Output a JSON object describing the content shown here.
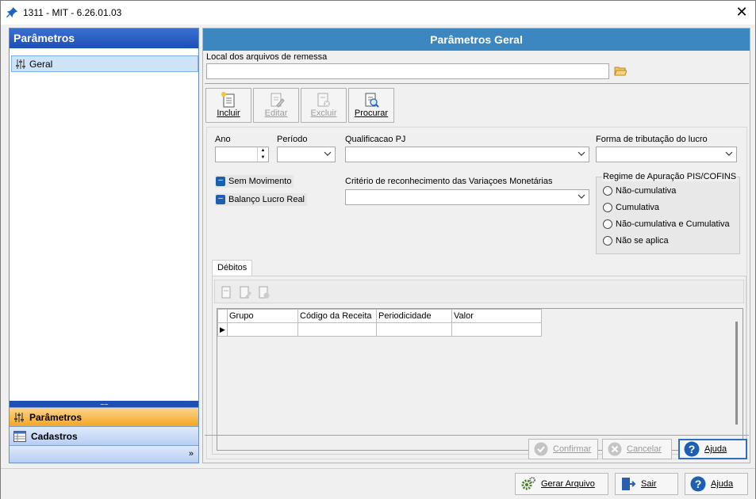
{
  "window": {
    "title": "1311 - MIT - 6.26.01.03"
  },
  "leftnav": {
    "header": "Parâmetros",
    "tree_items": [
      {
        "label": "Geral"
      }
    ],
    "splitter": "........",
    "buttons": [
      {
        "label": "Parâmetros"
      },
      {
        "label": "Cadastros"
      }
    ],
    "more": "»"
  },
  "main": {
    "header": "Parâmetros Geral",
    "local_label": "Local dos arquivos de remessa",
    "local_value": "",
    "toolbar": [
      {
        "label": "Incluir",
        "enabled": true
      },
      {
        "label": "Editar",
        "enabled": false
      },
      {
        "label": "Excluir",
        "enabled": false
      },
      {
        "label": "Procurar",
        "enabled": true
      }
    ],
    "form": {
      "ano_label": "Ano",
      "ano_value": "",
      "periodo_label": "Período",
      "periodo_value": "",
      "qualificacao_label": "Qualificacao PJ",
      "qualificacao_value": "",
      "forma_label": "Forma de tributação do lucro",
      "forma_value": "",
      "sem_movimento": "Sem Movimento",
      "balanco": "Balanço Lucro Real",
      "criterio_label": "Critério de reconhecimento das Variaçoes Monetárias",
      "criterio_value": "",
      "regime": {
        "title": "Regime de Apuração PIS/COFINS",
        "options": [
          "Não-cumulativa",
          "Cumulativa",
          "Não-cumulativa e Cumulativa",
          "Não se aplica"
        ]
      }
    },
    "tab": "Débitos",
    "grid": {
      "columns": [
        "Grupo",
        "Código da Receita",
        "Periodicidade",
        "Valor"
      ]
    },
    "actions": {
      "confirmar": "Confirmar",
      "cancelar": "Cancelar",
      "ajuda": "Ajuda"
    }
  },
  "footer": {
    "gerar": "Gerar Arquivo",
    "sair": "Sair",
    "ajuda": "Ajuda"
  }
}
